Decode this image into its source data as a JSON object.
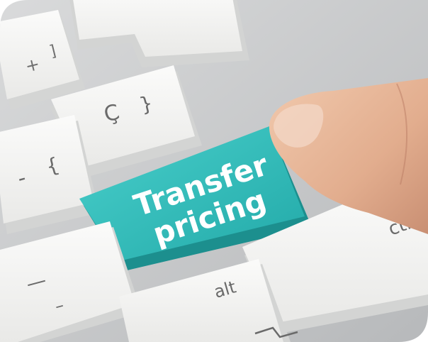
{
  "photo": {
    "hero_key": {
      "line1": "Transfer",
      "line2": "pricing",
      "color": "#2fbdbb"
    },
    "keys": {
      "plus_equals": {
        "top": "+",
        "bottom": "]"
      },
      "c_cedilla": {
        "main": "Ç",
        "alt": "}"
      },
      "minus_brace": {
        "main": "-",
        "alt": "{"
      },
      "dash": {
        "main": "—",
        "alt": "–"
      },
      "alt_key": {
        "label": "alt"
      },
      "ctrl_key": {
        "label": "ctrl"
      }
    },
    "colors": {
      "keyboard_body": "#c9cbcd",
      "key_face": "#f4f4f2",
      "key_side": "#d6d7d6",
      "skin": "#e8b99c"
    }
  }
}
